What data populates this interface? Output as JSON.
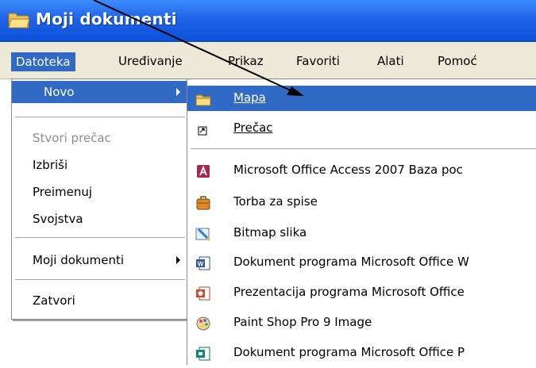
{
  "window": {
    "title": "Moji dokumenti",
    "icon": "folder-open-icon"
  },
  "menubar": {
    "items": [
      "Datoteka",
      "Uređivanje",
      "Prikaz",
      "Favoriti",
      "Alati",
      "Pomoć"
    ]
  },
  "file_menu": {
    "items": [
      "Novo",
      "Stvori prečac",
      "Izbriši",
      "Preimenuj",
      "Svojstva",
      "Moji dokumenti",
      "Zatvori"
    ]
  },
  "submenu": {
    "items": [
      {
        "label": "Mapa",
        "icon": "folder-icon"
      },
      {
        "label": "Prečac",
        "icon": "shortcut-icon"
      },
      {
        "label": "Microsoft Office Access 2007 Baza poc",
        "icon": "access-icon"
      },
      {
        "label": "Torba za spise",
        "icon": "briefcase-icon"
      },
      {
        "label": "Bitmap slika",
        "icon": "bitmap-icon"
      },
      {
        "label": "Dokument programa Microsoft Office W",
        "icon": "word-icon"
      },
      {
        "label": "Prezentacija programa Microsoft Office",
        "icon": "powerpoint-icon"
      },
      {
        "label": "Paint Shop Pro 9 Image",
        "icon": "paintshop-icon"
      },
      {
        "label": "Dokument programa Microsoft Office P",
        "icon": "publisher-icon"
      }
    ]
  },
  "colors": {
    "title_bar": "#0b4fd8",
    "highlight": "#316ac5",
    "menu_bg": "#ece9d8"
  }
}
